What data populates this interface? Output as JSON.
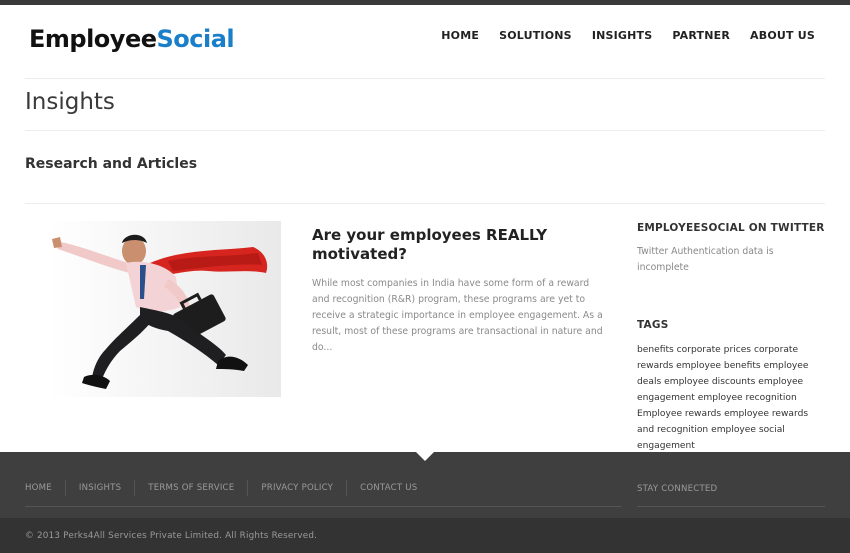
{
  "header": {
    "logo_part1": "Employee",
    "logo_part2": "Social",
    "nav": [
      "HOME",
      "SOLUTIONS",
      "INSIGHTS",
      "PARTNER",
      "ABOUT US"
    ]
  },
  "page": {
    "title": "Insights",
    "section_title": "Research and Articles"
  },
  "article": {
    "title": "Are your employees REALLY motivated?",
    "excerpt": "While most companies in India have some form of a reward and recognition (R&R) program, these programs are yet to receive a strategic importance in employee engagement. As a result, most of these programs are transactional in nature and do..."
  },
  "sidebar": {
    "twitter_heading": "EMPLOYEESOCIAL ON TWITTER",
    "twitter_note": "Twitter Authentication data is incomplete",
    "tags_heading": "TAGS",
    "tags": [
      "benefits",
      "corporate prices",
      "corporate rewards",
      "employee benefits",
      "employee deals",
      "employee discounts",
      "employee engagement",
      "employee recognition",
      "Employee rewards",
      "employee rewards and recognition",
      "employee social engagement"
    ]
  },
  "footer": {
    "links": [
      "HOME",
      "INSIGHTS",
      "TERMS OF SERVICE",
      "PRIVACY POLICY",
      "CONTACT US"
    ],
    "stay_connected": "STAY CONNECTED",
    "copyright": "© 2013 Perks4All Services Private Limited. All Rights Reserved."
  },
  "colors": {
    "brand_blue": "#1a7fc8",
    "footer_bg": "#3f3f3f",
    "copyright_bg": "#333333",
    "cape_red": "#d6251f"
  }
}
